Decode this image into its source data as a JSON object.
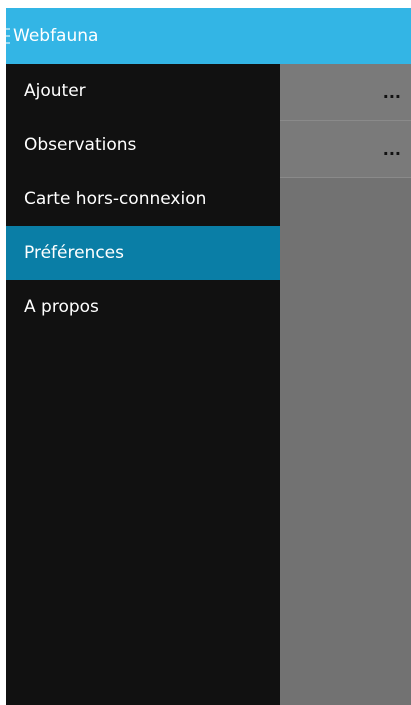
{
  "action_bar": {
    "title": "Webfauna",
    "menu_icon": "hamburger-menu-icon",
    "color": "#33b5e5"
  },
  "drawer": {
    "items": [
      {
        "label": "Ajouter"
      },
      {
        "label": "Observations"
      },
      {
        "label": "Carte hors-connexion"
      },
      {
        "label": "Préférences",
        "selected": true
      },
      {
        "label": "A propos"
      }
    ],
    "background": "#111111",
    "selected_color": "#0a7ea6"
  },
  "content": {
    "rows": [
      {
        "overflow_label": "..."
      },
      {
        "overflow_label": "..."
      }
    ],
    "overflow_icon": "more-options-icon"
  }
}
